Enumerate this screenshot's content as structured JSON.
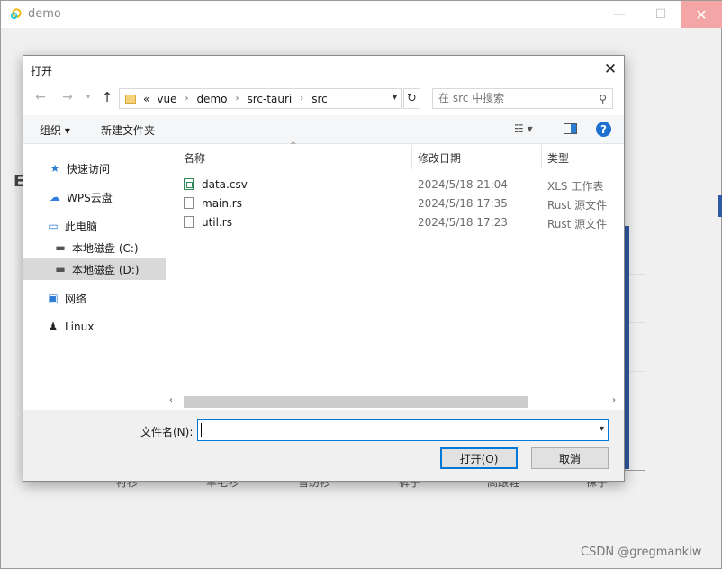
{
  "app": {
    "title": "demo",
    "background_heading": "E",
    "axis_labels": [
      "衬衫",
      "羊毛衫",
      "雪纺衫",
      "裤子",
      "高跟鞋",
      "袜子"
    ]
  },
  "dialog": {
    "title": "打开",
    "address": {
      "prefix": "«",
      "crumbs": [
        "vue",
        "demo",
        "src-tauri",
        "src"
      ]
    },
    "search": {
      "placeholder": "在 src 中搜索"
    },
    "toolbar": {
      "organize": "组织 ▾",
      "new_folder": "新建文件夹",
      "view": "☷ ▾",
      "help": "?"
    },
    "sidebar": {
      "items": [
        {
          "label": "快速访问",
          "icon": "star-icon"
        },
        {
          "label": "WPS云盘",
          "icon": "cloud-icon"
        },
        {
          "label": "此电脑",
          "icon": "computer-icon"
        },
        {
          "label": "本地磁盘 (C:)",
          "icon": "drive-icon"
        },
        {
          "label": "本地磁盘 (D:)",
          "icon": "drive-icon",
          "selected": true
        },
        {
          "label": "网络",
          "icon": "network-icon"
        },
        {
          "label": "Linux",
          "icon": "penguin-icon"
        }
      ]
    },
    "columns": {
      "name": "名称",
      "modified": "修改日期",
      "type": "类型"
    },
    "files": [
      {
        "name": "data.csv",
        "modified": "2024/5/18 21:04",
        "type": "XLS 工作表"
      },
      {
        "name": "main.rs",
        "modified": "2024/5/18 17:35",
        "type": "Rust 源文件"
      },
      {
        "name": "util.rs",
        "modified": "2024/5/18 17:23",
        "type": "Rust 源文件"
      }
    ],
    "filename": {
      "label": "文件名(N):",
      "value": ""
    },
    "buttons": {
      "open": "打开(O)",
      "cancel": "取消"
    }
  },
  "watermark": "CSDN @gregmankiw",
  "colors": {
    "accent": "#0078d7",
    "chart_bar": "#2f59a3",
    "close_hover": "#f4a5a5"
  }
}
